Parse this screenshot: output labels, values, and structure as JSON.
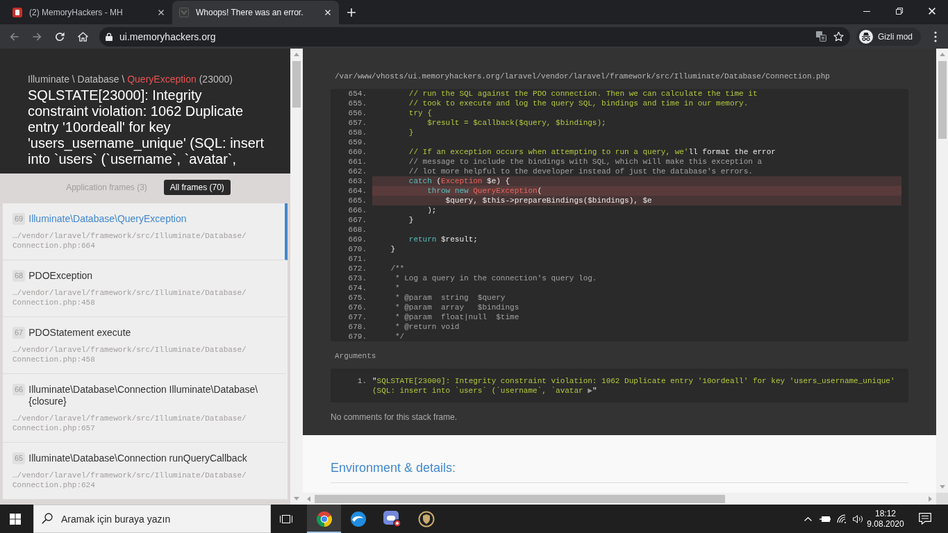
{
  "browser": {
    "tabs": [
      {
        "title": "(2) MemoryHackers - MH",
        "selected": false
      },
      {
        "title": "Whoops! There was an error.",
        "selected": true
      }
    ],
    "back_disabled": true,
    "forward_disabled": true,
    "address": "ui.memoryhackers.org",
    "profile": "Gizli mod"
  },
  "exception": {
    "namespace": "Illuminate \\ Database \\",
    "class_name": "QueryException",
    "code": "(23000)",
    "message": "SQLSTATE[23000]: Integrity constraint violation: 1062 Duplicate entry '10ordeall' for key 'users_username_unique' (SQL: insert into `users` (`username`, `avatar`,"
  },
  "frame_filters": [
    {
      "label": "Application frames (3)",
      "selected": false
    },
    {
      "label": "All frames (70)",
      "selected": true
    }
  ],
  "frames": [
    {
      "number": "69",
      "title": "Illuminate\\Database\\QueryException",
      "file": "…/vendor/laravel/framework/src/Illuminate/Database/Connection.php:664",
      "selected": true
    },
    {
      "number": "68",
      "title": "PDOException",
      "file": "…/vendor/laravel/framework/src/Illuminate/Database/Connection.php:458",
      "selected": false
    },
    {
      "number": "67",
      "title": "PDOStatement execute",
      "file": "…/vendor/laravel/framework/src/Illuminate/Database/Connection.php:458",
      "selected": false
    },
    {
      "number": "66",
      "title": "Illuminate\\Database\\Connection Illuminate\\Database\\{closure}",
      "file": "…/vendor/laravel/framework/src/Illuminate/Database/Connection.php:657",
      "selected": false
    },
    {
      "number": "65",
      "title": "Illuminate\\Database\\Connection runQueryCallback",
      "file": "…/vendor/laravel/framework/src/Illuminate/Database/Connection.php:624",
      "selected": false
    }
  ],
  "code_view": {
    "path": "/var/www/vhosts/ui.memoryhackers.org/laravel/vendor/laravel/framework/src/Illuminate/Database/Connection.php",
    "lines": [
      {
        "number": "654.",
        "highlighted": false,
        "current": false,
        "tokens": [
          {
            "kind": "string",
            "text": "        // run the SQL against the PDO connection. Then we can calculate the time it"
          }
        ]
      },
      {
        "number": "655.",
        "highlighted": false,
        "current": false,
        "tokens": [
          {
            "kind": "string",
            "text": "        // took to execute and log the query SQL, bindings and time in our memory."
          }
        ]
      },
      {
        "number": "656.",
        "highlighted": false,
        "current": false,
        "tokens": [
          {
            "kind": "string",
            "text": "        try {"
          }
        ]
      },
      {
        "number": "657.",
        "highlighted": false,
        "current": false,
        "tokens": [
          {
            "kind": "string",
            "text": "            $result = $callback($query, $bindings);"
          }
        ]
      },
      {
        "number": "658.",
        "highlighted": false,
        "current": false,
        "tokens": [
          {
            "kind": "string",
            "text": "        }"
          }
        ]
      },
      {
        "number": "659.",
        "highlighted": false,
        "current": false
      },
      {
        "number": "660.",
        "highlighted": false,
        "current": false,
        "tokens": [
          {
            "kind": "string",
            "text": "        // If an exception occurs when attempting to run a query, we'"
          },
          {
            "kind": "plain",
            "text": "ll format the error"
          }
        ]
      },
      {
        "number": "661.",
        "highlighted": false,
        "current": false,
        "tokens": [
          {
            "kind": "comment",
            "text": "        // message to include the bindings with SQL, which will make this exception a"
          }
        ]
      },
      {
        "number": "662.",
        "highlighted": false,
        "current": false,
        "tokens": [
          {
            "kind": "comment",
            "text": "        // lot more helpful to the developer instead of just the database's errors."
          }
        ]
      },
      {
        "number": "663.",
        "highlighted": true,
        "current": false,
        "tokens": [
          {
            "kind": "keyword",
            "text": "        catch"
          },
          {
            "kind": "plain",
            "text": " ("
          },
          {
            "kind": "type",
            "text": "Exception"
          },
          {
            "kind": "plain",
            "text": " $e) {"
          }
        ]
      },
      {
        "number": "664.",
        "highlighted": true,
        "current": true,
        "tokens": [
          {
            "kind": "keyword",
            "text": "            throw new "
          },
          {
            "kind": "type",
            "text": "QueryException"
          },
          {
            "kind": "plain",
            "text": "("
          }
        ]
      },
      {
        "number": "665.",
        "highlighted": true,
        "current": false,
        "tokens": [
          {
            "kind": "plain",
            "text": "                $query, $this->prepareBindings($bindings), $e"
          }
        ]
      },
      {
        "number": "666.",
        "highlighted": false,
        "current": false,
        "tokens": [
          {
            "kind": "plain",
            "text": "            );"
          }
        ]
      },
      {
        "number": "667.",
        "highlighted": false,
        "current": false,
        "tokens": [
          {
            "kind": "plain",
            "text": "        }"
          }
        ]
      },
      {
        "number": "668.",
        "highlighted": false,
        "current": false
      },
      {
        "number": "669.",
        "highlighted": false,
        "current": false,
        "tokens": [
          {
            "kind": "keyword",
            "text": "        return"
          },
          {
            "kind": "plain",
            "text": " $result;"
          }
        ]
      },
      {
        "number": "670.",
        "highlighted": false,
        "current": false,
        "tokens": [
          {
            "kind": "plain",
            "text": "    }"
          }
        ]
      },
      {
        "number": "671.",
        "highlighted": false,
        "current": false
      },
      {
        "number": "672.",
        "highlighted": false,
        "current": false,
        "tokens": [
          {
            "kind": "comment",
            "text": "    /**"
          }
        ]
      },
      {
        "number": "673.",
        "highlighted": false,
        "current": false,
        "tokens": [
          {
            "kind": "comment",
            "text": "     * Log a query in the connection's query log."
          }
        ]
      },
      {
        "number": "674.",
        "highlighted": false,
        "current": false,
        "tokens": [
          {
            "kind": "comment",
            "text": "     *"
          }
        ]
      },
      {
        "number": "675.",
        "highlighted": false,
        "current": false,
        "tokens": [
          {
            "kind": "comment",
            "text": "     * @param  string  $query"
          }
        ]
      },
      {
        "number": "676.",
        "highlighted": false,
        "current": false,
        "tokens": [
          {
            "kind": "comment",
            "text": "     * @param  array   $bindings"
          }
        ]
      },
      {
        "number": "677.",
        "highlighted": false,
        "current": false,
        "tokens": [
          {
            "kind": "comment",
            "text": "     * @param  float|null  $time"
          }
        ]
      },
      {
        "number": "678.",
        "highlighted": false,
        "current": false,
        "tokens": [
          {
            "kind": "comment",
            "text": "     * @return void"
          }
        ]
      },
      {
        "number": "679.",
        "highlighted": false,
        "current": false,
        "tokens": [
          {
            "kind": "comment",
            "text": "     */"
          }
        ]
      }
    ]
  },
  "arguments": {
    "heading": "Arguments",
    "items": [
      {
        "number": "1.",
        "tokens": [
          {
            "kind": "plain",
            "text": "\""
          },
          {
            "kind": "string",
            "text": "SQLSTATE[23000]: Integrity constraint violation: 1062 Duplicate entry '10ordeall' for key 'users_username_unique' (SQL: insert into `users` (`username`, `avatar "
          },
          {
            "kind": "toggle",
            "text": "▶"
          },
          {
            "kind": "plain",
            "text": "\""
          }
        ]
      }
    ]
  },
  "comments_note": "No comments for this stack frame.",
  "details": {
    "heading": "Environment & details:"
  },
  "taskbar": {
    "search_placeholder": "Aramak için buraya yazın",
    "apps": [
      {
        "kind": "chrome",
        "active": true
      },
      {
        "kind": "edge",
        "active": false
      },
      {
        "kind": "chat",
        "active": false
      },
      {
        "kind": "game",
        "active": false
      }
    ],
    "time": "18:12",
    "date": "9.08.2020"
  }
}
